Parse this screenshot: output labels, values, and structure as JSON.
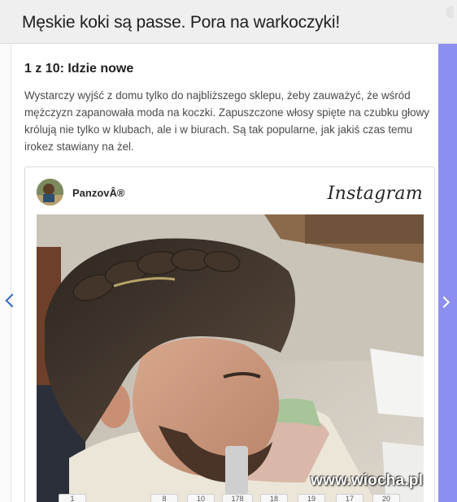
{
  "header": {
    "title": "Męskie koki są passe. Pora na warkoczyki!"
  },
  "slide": {
    "counter": "1 z 10: Idzie nowe",
    "description": "Wystarczy wyjść z domu tylko do najbliższego sklepu, żeby zauważyć, że wśród mężczyzn zapanowała moda na koczki. Zapuszczone włosy spięte na czubku głowy królują nie tylko w klubach, ale i w biurach. Są tak popularne, jak jakiś czas temu irokez stawiany na żel."
  },
  "embed": {
    "username": "PanzovÂ®",
    "brand": "Instagram"
  },
  "pager": {
    "pages": [
      "1",
      "8",
      "10",
      "178",
      "18",
      "19",
      "17",
      "20"
    ]
  },
  "watermark": "www.wiocha.pl",
  "icons": {
    "prev": "chevron-left-icon",
    "next": "chevron-right-icon"
  },
  "colors": {
    "nav_bar": "#8c8ff0",
    "arrow": "#2f67c6"
  }
}
